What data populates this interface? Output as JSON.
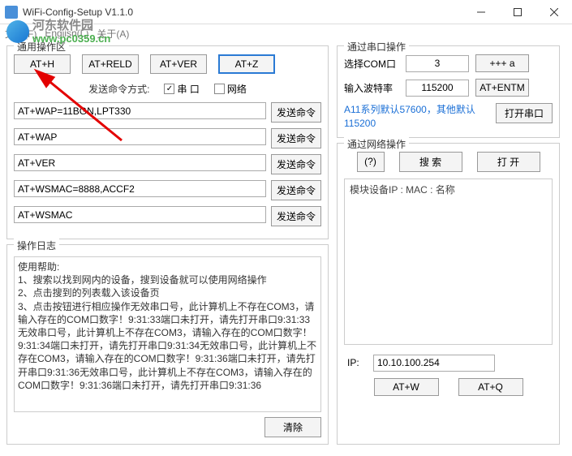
{
  "window": {
    "title": "WiFi-Config-Setup V1.1.0"
  },
  "menu": {
    "file": "文件(F)",
    "lang": "English(L)",
    "about": "关于(A)"
  },
  "watermark": {
    "name": "河东软件园",
    "url": "www.pc0359.cn"
  },
  "common_area": {
    "title": "通用操作区",
    "buttons": {
      "ath": "AT+H",
      "atreld": "AT+RELD",
      "atver": "AT+VER",
      "atz": "AT+Z"
    },
    "send_mode_label": "发送命令方式:",
    "serial_cb": "串 口",
    "net_cb": "网络",
    "rows": [
      {
        "value": "AT+WAP=11BGN,LPT330",
        "btn": "发送命令"
      },
      {
        "value": "AT+WAP",
        "btn": "发送命令"
      },
      {
        "value": "AT+VER",
        "btn": "发送命令"
      },
      {
        "value": "AT+WSMAC=8888,ACCF2",
        "btn": "发送命令"
      },
      {
        "value": "AT+WSMAC",
        "btn": "发送命令"
      }
    ]
  },
  "log": {
    "title": "操作日志",
    "help_title": "使用帮助:",
    "lines": [
      "1、搜索以找到网内的设备，搜到设备就可以使用网络操作",
      "2、点击搜到的列表载入该设备页",
      "3、点击按钮进行相应操作无效串口号，此计算机上不存在COM3，请输入存在的COM口数字！9:31:33端口未打开，请先打开串口9:31:33无效串口号，此计算机上不存在COM3，请输入存在的COM口数字！9:31:34端口未打开，请先打开串口9:31:34无效串口号，此计算机上不存在COM3，请输入存在的COM口数字！9:31:36端口未打开，请先打开串口9:31:36无效串口号，此计算机上不存在COM3，请输入存在的COM口数字！9:31:36端口未打开，请先打开串口9:31:36"
    ],
    "clear": "清除"
  },
  "serial_panel": {
    "title": "通过串口操作",
    "com_label": "选择COM口",
    "com_value": "3",
    "ppp_btn": "+++ a",
    "baud_label": "输入波特率",
    "baud_value": "115200",
    "entm_btn": "AT+ENTM",
    "note": "A11系列默认57600，其他默认115200",
    "open_btn": "打开串口"
  },
  "net_panel": {
    "title": "通过网络操作",
    "q_btn": "(?)",
    "search_btn": "搜 索",
    "open_btn": "打 开",
    "list_header": "模块设备IP    :    MAC    :    名称",
    "ip_label": "IP:",
    "ip_value": "10.10.100.254",
    "atw_btn": "AT+W",
    "atq_btn": "AT+Q"
  }
}
